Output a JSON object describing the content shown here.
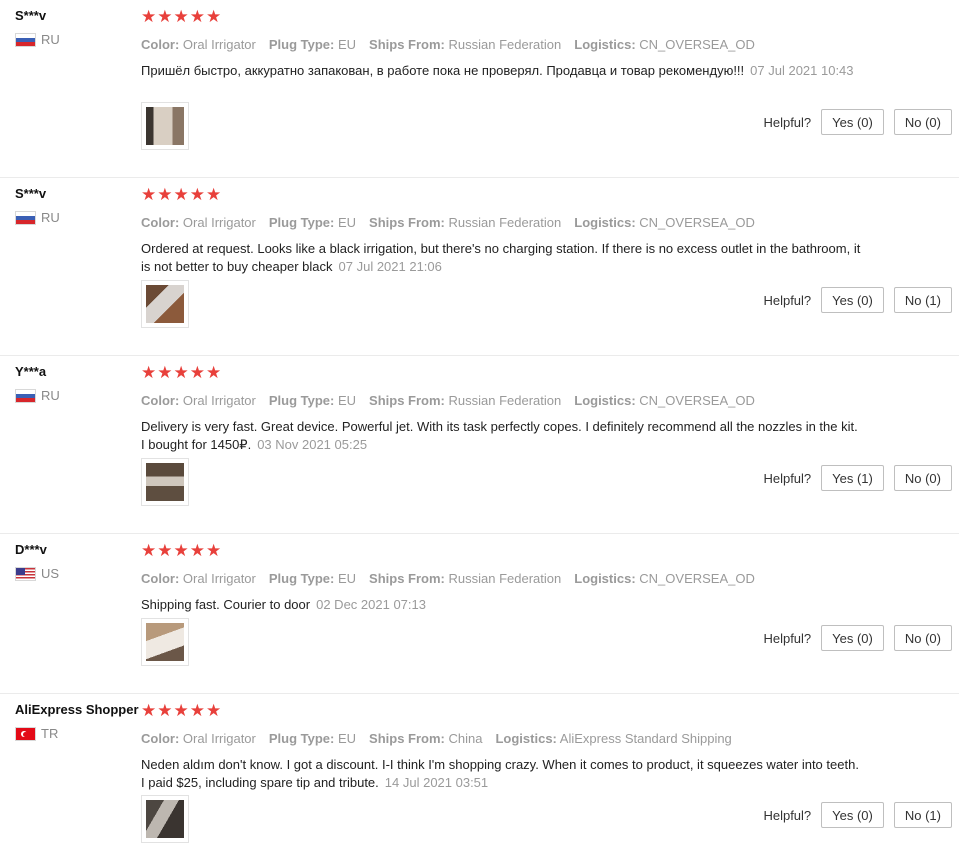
{
  "labels": {
    "color": "Color:",
    "plug_type": "Plug Type:",
    "ships_from": "Ships From:",
    "logistics": "Logistics:",
    "helpful": "Helpful?"
  },
  "reviews": [
    {
      "user": "S***v",
      "country": "RU",
      "rating": 5,
      "color": "Oral Irrigator",
      "plug_type": "EU",
      "ships_from": "Russian Federation",
      "logistics": "CN_OVERSEA_OD",
      "text": "Пришёл быстро, аккуратно запакован, в работе пока не проверял. Продавца и товар рекомендую!!!",
      "date": "07 Jul 2021 10:43",
      "yes": "Yes (0)",
      "no": "No (0)"
    },
    {
      "user": "S***v",
      "country": "RU",
      "rating": 5,
      "color": "Oral Irrigator",
      "plug_type": "EU",
      "ships_from": "Russian Federation",
      "logistics": "CN_OVERSEA_OD",
      "text": "Ordered at request. Looks like a black irrigation, but there's no charging station. If there is no excess outlet in the bathroom, it is not better to buy cheaper black",
      "date": "07 Jul 2021 21:06",
      "yes": "Yes (0)",
      "no": "No (1)"
    },
    {
      "user": "Y***a",
      "country": "RU",
      "rating": 5,
      "color": "Oral Irrigator",
      "plug_type": "EU",
      "ships_from": "Russian Federation",
      "logistics": "CN_OVERSEA_OD",
      "text": "Delivery is very fast. Great device. Powerful jet. With its task perfectly copes. I definitely recommend all the nozzles in the kit. I bought for 1450₽.",
      "date": "03 Nov 2021 05:25",
      "yes": "Yes (1)",
      "no": "No (0)"
    },
    {
      "user": "D***v",
      "country": "US",
      "rating": 5,
      "color": "Oral Irrigator",
      "plug_type": "EU",
      "ships_from": "Russian Federation",
      "logistics": "CN_OVERSEA_OD",
      "text": "Shipping fast. Courier to door",
      "date": "02 Dec 2021 07:13",
      "yes": "Yes (0)",
      "no": "No (0)"
    },
    {
      "user": "AliExpress Shopper",
      "country": "TR",
      "rating": 5,
      "color": "Oral Irrigator",
      "plug_type": "EU",
      "ships_from": "China",
      "logistics": "AliExpress Standard Shipping",
      "text": "Neden aldım don't know. I got a discount. I-I think I'm shopping crazy. When it comes to product, it squeezes water into teeth. I paid $25, including spare tip and tribute.",
      "date": "14 Jul 2021 03:51",
      "yes": "Yes (0)",
      "no": "No (1)"
    }
  ]
}
